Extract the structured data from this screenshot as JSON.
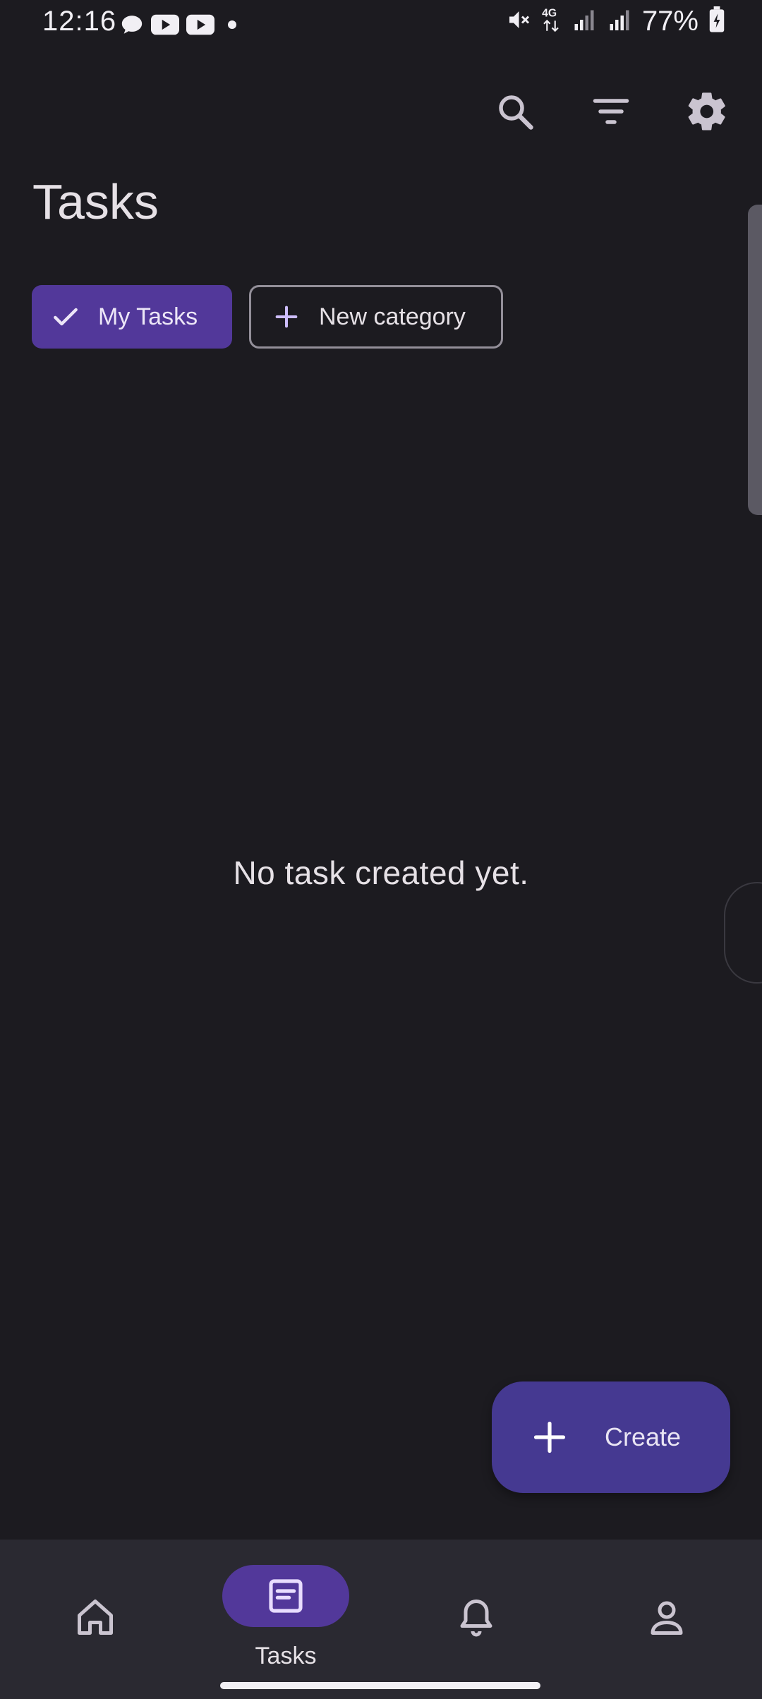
{
  "status_bar": {
    "time": "12:16",
    "battery": "77%",
    "network": "4G",
    "left_icons": [
      "chat-bubble-icon",
      "youtube-icon",
      "youtube-icon",
      "dot-icon"
    ],
    "right_icons": [
      "mute-icon",
      "network-4g-icon",
      "signal-icon",
      "signal-icon",
      "battery-icon"
    ]
  },
  "toolbar": {
    "actions": [
      "search-icon",
      "filter-icon",
      "settings-icon"
    ]
  },
  "page": {
    "title": "Tasks"
  },
  "chips": {
    "selected": {
      "label": "My Tasks",
      "icon": "check-icon"
    },
    "new": {
      "label": "New category",
      "icon": "plus-icon"
    }
  },
  "empty_state": {
    "message": "No task created yet."
  },
  "fab": {
    "label": "Create",
    "icon": "plus-icon"
  },
  "bottom_nav": {
    "items": [
      {
        "icon": "home-icon",
        "label": ""
      },
      {
        "icon": "tasks-icon",
        "label": "Tasks",
        "active": true
      },
      {
        "icon": "bell-icon",
        "label": ""
      },
      {
        "icon": "person-icon",
        "label": ""
      }
    ]
  },
  "colors": {
    "background": "#1c1b20",
    "accent": "#52389a",
    "fab": "#453991",
    "nav_background": "#2a2931"
  }
}
